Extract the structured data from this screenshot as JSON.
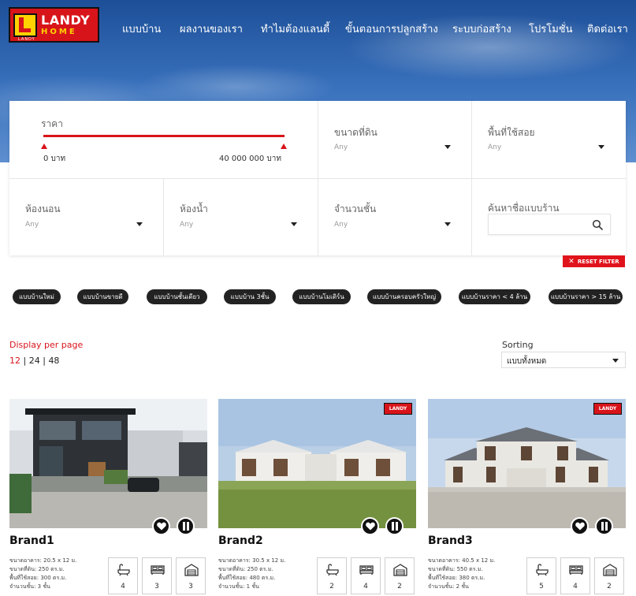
{
  "brand": {
    "name": "LANDY",
    "sub": "HOME",
    "tiny": "LANDY"
  },
  "nav": [
    "แบบบ้าน",
    "ผลงานของเรา",
    "ทำไมต้องแลนดี้",
    "ขั้นตอนการปลูกสร้าง",
    "ระบบก่อสร้าง",
    "โปรโมชั่น",
    "ติดต่อเรา"
  ],
  "filter": {
    "price_label": "ราคา",
    "price_min": "0 บาท",
    "price_max": "40 000 000 บาท",
    "land_size": {
      "label": "ขนาดที่ดิน",
      "value": "Any"
    },
    "usable_area": {
      "label": "พื้นที่ใช้สอย",
      "value": "Any"
    },
    "bedrooms": {
      "label": "ห้องนอน",
      "value": "Any"
    },
    "bathrooms": {
      "label": "ห้องน้ำ",
      "value": "Any"
    },
    "floors": {
      "label": "จำนวนชั้น",
      "value": "Any"
    },
    "search": {
      "label": "ค้นหาชื่อแบบร้าน",
      "placeholder": ""
    },
    "reset_label": "RESET FILTER"
  },
  "tags": [
    "แบบบ้านใหม่",
    "แบบบ้านขายดี",
    "แบบบ้านชั้นเดียว",
    "แบบบ้าน 3ชั้น",
    "แบบบ้านโมเดิร์น",
    "แบบบ้านครอบครัวใหญ่",
    "แบบบ้านราคา < 4 ล้าน",
    "แบบบ้านราคา > 15 ล้าน"
  ],
  "display": {
    "label": "Display per page",
    "options": [
      "12",
      "24",
      "48"
    ],
    "separator": "|",
    "active": "12"
  },
  "sorting": {
    "label": "Sorting",
    "value": "แบบทั้งหมด"
  },
  "cards": [
    {
      "title": "Brand1",
      "specs": [
        "ขนาดอาคาร: 20.5 x 12 ม.",
        "ขนาดที่ดิน: 250 ตร.ม.",
        "พื้นที่ใช้สอย: 300 ตร.ม.",
        "จำนวนชั้น: 3 ชั้น"
      ],
      "bath": "4",
      "bed": "3",
      "garage": "3",
      "has_badge": false
    },
    {
      "title": "Brand2",
      "specs": [
        "ขนาดอาคาร: 30.5 x 12 ม.",
        "ขนาดที่ดิน: 250 ตร.ม.",
        "พื้นที่ใช้สอย: 480 ตร.ม.",
        "จำนวนชั้น: 1 ชั้น"
      ],
      "bath": "2",
      "bed": "4",
      "garage": "2",
      "has_badge": true
    },
    {
      "title": "Brand3",
      "specs": [
        "ขนาดอาคาร: 40.5 x 12 ม.",
        "ขนาดที่ดิน: 550 ตร.ม.",
        "พื้นที่ใช้สอย: 380 ตร.ม.",
        "จำนวนชั้น: 2 ชั้น"
      ],
      "bath": "5",
      "bed": "4",
      "garage": "2",
      "has_badge": true
    }
  ],
  "colors": {
    "accent": "#d8141b",
    "chip": "#222222",
    "hero": "#2f63ad"
  }
}
